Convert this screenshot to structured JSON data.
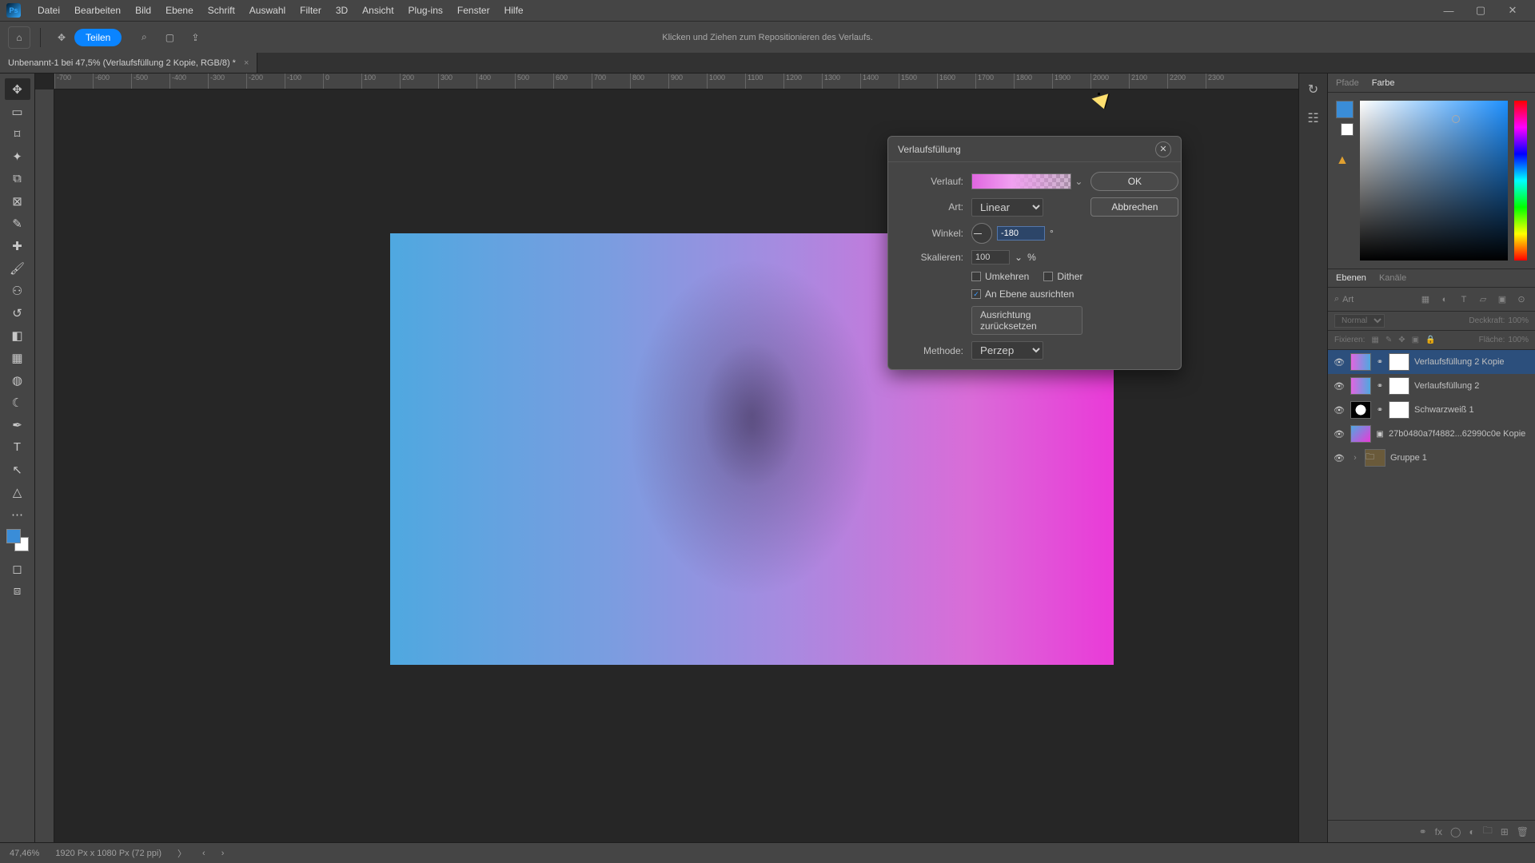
{
  "menu": {
    "items": [
      "Datei",
      "Bearbeiten",
      "Bild",
      "Ebene",
      "Schrift",
      "Auswahl",
      "Filter",
      "3D",
      "Ansicht",
      "Plug-ins",
      "Fenster",
      "Hilfe"
    ],
    "logo": "Ps"
  },
  "options": {
    "hint": "Klicken und Ziehen zum Repositionieren des Verlaufs.",
    "share": "Teilen"
  },
  "doctab": {
    "title": "Unbenannt-1 bei 47,5% (Verlaufsfüllung 2 Kopie, RGB/8) *"
  },
  "ruler_h": [
    "-700",
    "-600",
    "-500",
    "-400",
    "-300",
    "-200",
    "-100",
    "0",
    "100",
    "200",
    "300",
    "400",
    "500",
    "600",
    "700",
    "800",
    "900",
    "1000",
    "1100",
    "1200",
    "1300",
    "1400",
    "1500",
    "1600",
    "1700",
    "1800",
    "1900",
    "2000",
    "2100",
    "2200",
    "2300"
  ],
  "panels": {
    "top_tabs": {
      "pfade": "Pfade",
      "farbe": "Farbe"
    },
    "layers_tabs": {
      "ebenen": "Ebenen",
      "kanaele": "Kanäle"
    },
    "filter_label": "Art",
    "blend_mode": "Normal",
    "opacity_label": "Deckkraft:",
    "opacity_value": "100%",
    "lock_label": "Fixieren:",
    "fill_label": "Fläche:",
    "fill_value": "100%"
  },
  "layers": [
    {
      "name": "Verlaufsfüllung 2 Kopie",
      "selected": true,
      "hasLink": true
    },
    {
      "name": "Verlaufsfüllung 2",
      "selected": false,
      "hasLink": true
    },
    {
      "name": "Schwarzweiß 1",
      "selected": false,
      "hasLink": true,
      "adjust": true
    },
    {
      "name": "27b0480a7f4882...62990c0e Kopie",
      "selected": false,
      "isImage": true
    },
    {
      "name": "Gruppe 1",
      "selected": false,
      "isGroup": true
    }
  ],
  "status": {
    "zoom": "47,46%",
    "dims": "1920 Px x 1080 Px (72 ppi)"
  },
  "dialog": {
    "title": "Verlaufsfüllung",
    "labels": {
      "verlauf": "Verlauf:",
      "art": "Art:",
      "winkel": "Winkel:",
      "skalieren": "Skalieren:",
      "methode": "Methode:"
    },
    "art_value": "Linear",
    "winkel_value": "-180",
    "skalieren_value": "100",
    "skalieren_unit": "%",
    "winkel_unit": "°",
    "umkehren": "Umkehren",
    "dither": "Dither",
    "align": "An Ebene ausrichten",
    "reset": "Ausrichtung zurücksetzen",
    "methode_value": "Perzeptiv",
    "ok": "OK",
    "cancel": "Abbrechen"
  }
}
